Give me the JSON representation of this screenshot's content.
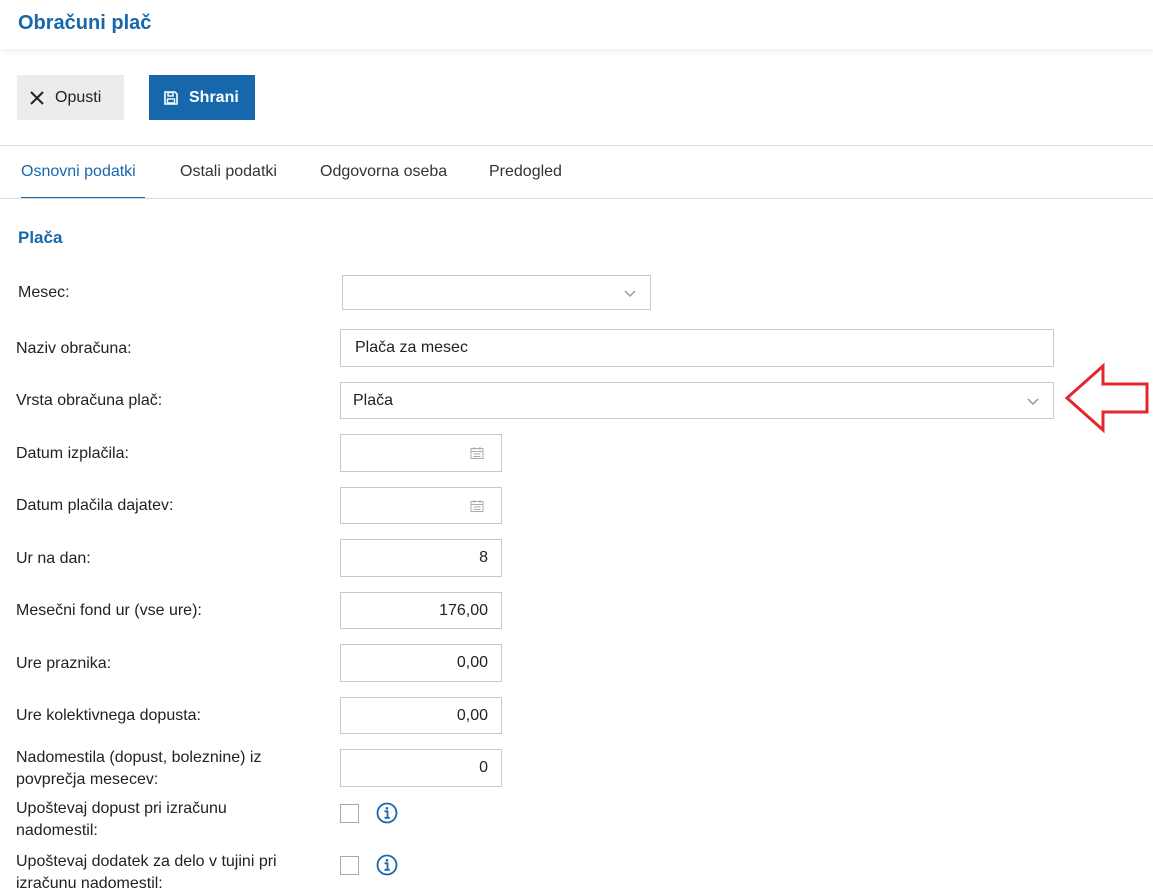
{
  "header": {
    "title": "Obračuni plač"
  },
  "toolbar": {
    "cancel_label": "Opusti",
    "save_label": "Shrani"
  },
  "tabs": [
    {
      "label": "Osnovni podatki",
      "active": true
    },
    {
      "label": "Ostali podatki",
      "active": false
    },
    {
      "label": "Odgovorna oseba",
      "active": false
    },
    {
      "label": "Predogled",
      "active": false
    }
  ],
  "section": {
    "title": "Plača"
  },
  "form": {
    "mesec": {
      "label": "Mesec:",
      "value": ""
    },
    "naziv": {
      "label": "Naziv obračuna:",
      "value": "Plača za mesec"
    },
    "vrsta": {
      "label": "Vrsta obračuna plač:",
      "value": "Plača"
    },
    "datum_izplacila": {
      "label": "Datum izplačila:",
      "value": ""
    },
    "datum_placila": {
      "label": "Datum plačila dajatev:",
      "value": ""
    },
    "ur_na_dan": {
      "label": "Ur na dan:",
      "value": "8"
    },
    "mesecni_fond": {
      "label": "Mesečni fond ur (vse ure):",
      "value": "176,00"
    },
    "ure_praznika": {
      "label": "Ure praznika:",
      "value": "0,00"
    },
    "ure_kolektivnega": {
      "label": "Ure kolektivnega dopusta:",
      "value": "0,00"
    },
    "nadomestila": {
      "label_line1": "Nadomestila (dopust, boleznine) iz",
      "label_line2": "povprečja mesecev:",
      "value": "0"
    },
    "upostevaj_dopust": {
      "label_line1": "Upoštevaj dopust pri izračunu",
      "label_line2": "nadomestil:",
      "checked": false
    },
    "upostevaj_dodatek": {
      "label_line1": "Upoštevaj dodatek za delo v tujini pri",
      "label_line2": "izračunu nadomestil:",
      "checked": false
    }
  },
  "colors": {
    "accent": "#1767ad",
    "annotation_arrow": "#e0282e"
  },
  "icons": {
    "cancel": "close-icon",
    "save": "save-icon",
    "calendar": "calendar-icon",
    "dropdown": "chevron-down-icon",
    "info": "info-icon",
    "annotation": "arrow-left-icon"
  }
}
